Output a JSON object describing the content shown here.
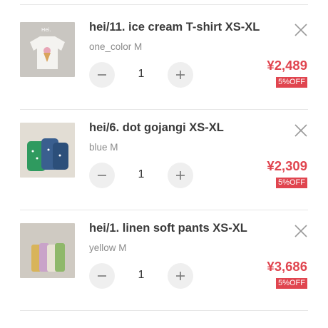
{
  "colors": {
    "price": "#e0454f",
    "badge_bg": "#e0454f",
    "divider": "#e6e6e6",
    "stepper_bg": "#efefef"
  },
  "cart": {
    "items": [
      {
        "title": "hei/11. ice cream T-shirt XS-XL",
        "variant": "one_color M",
        "quantity": "1",
        "price": "¥2,489",
        "discount": "5%OFF",
        "thumb_text": "Hei.",
        "icons": {
          "remove": "close-icon",
          "decrease": "minus-icon",
          "increase": "plus-icon"
        }
      },
      {
        "title": "hei/6. dot gojangi XS-XL",
        "variant": "blue M",
        "quantity": "1",
        "price": "¥2,309",
        "discount": "5%OFF",
        "icons": {
          "remove": "close-icon",
          "decrease": "minus-icon",
          "increase": "plus-icon"
        }
      },
      {
        "title": "hei/1. linen soft pants XS-XL",
        "variant": "yellow M",
        "quantity": "1",
        "price": "¥3,686",
        "discount": "5%OFF",
        "icons": {
          "remove": "close-icon",
          "decrease": "minus-icon",
          "increase": "plus-icon"
        }
      }
    ]
  }
}
